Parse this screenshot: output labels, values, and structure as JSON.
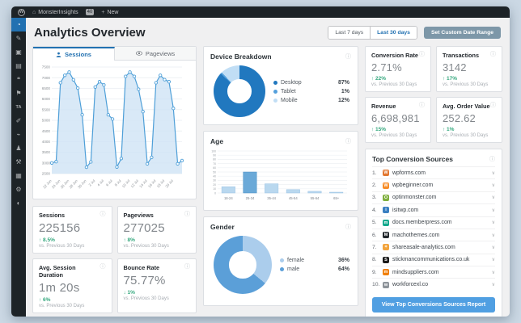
{
  "admin_bar": {
    "site_name": "MonsterInsights",
    "comments_count": "40",
    "new_label": "New",
    "wp_logo_letter": "W"
  },
  "sidebar": {
    "items": [
      {
        "name": "dashboard",
        "glyph": "◔",
        "active": true
      },
      {
        "name": "posts",
        "glyph": "✎",
        "active": false
      },
      {
        "name": "media",
        "glyph": "▣",
        "active": false
      },
      {
        "name": "pages",
        "glyph": "▤",
        "active": false
      },
      {
        "name": "comments",
        "glyph": "❝",
        "active": false
      },
      {
        "name": "feedback",
        "glyph": "⚑",
        "active": false
      },
      {
        "name": "thirstyaffiliates",
        "glyph": "TA",
        "active": false
      },
      {
        "name": "appearance",
        "glyph": "✐",
        "active": false
      },
      {
        "name": "plugins",
        "glyph": "⌁",
        "active": false
      },
      {
        "name": "users",
        "glyph": "♟",
        "active": false
      },
      {
        "name": "tools",
        "glyph": "⚒",
        "active": false
      },
      {
        "name": "modules",
        "glyph": "▦",
        "active": false
      },
      {
        "name": "settings",
        "glyph": "⚙",
        "active": false
      },
      {
        "name": "collapse-menu",
        "glyph": "◐",
        "active": false
      }
    ]
  },
  "header": {
    "title": "Analytics Overview",
    "last7_label": "Last 7 days",
    "last30_label": "Last 30 days",
    "custom_range_label": "Set Custom Date Range"
  },
  "sessions_panel": {
    "tab_sessions": "Sessions",
    "tab_pageviews": "Pageviews"
  },
  "device_panel_title": "Device Breakdown",
  "age_panel_title": "Age",
  "gender_panel_title": "Gender",
  "stats_left": [
    {
      "label": "Sessions",
      "value": "225156",
      "change": "8.5%",
      "direction": "up",
      "sub": "vs. Previous 30 Days"
    },
    {
      "label": "Pageviews",
      "value": "277025",
      "change": "8%",
      "direction": "up",
      "sub": "vs. Previous 30 Days"
    },
    {
      "label": "Avg. Session Duration",
      "value": "1m 20s",
      "change": "6%",
      "direction": "up",
      "sub": "vs. Previous 30 Days"
    },
    {
      "label": "Bounce Rate",
      "value": "75.77%",
      "change": "1%",
      "direction": "down",
      "sub": "vs. Previous 30 Days"
    }
  ],
  "stats_right": [
    {
      "label": "Conversion Rate",
      "value": "2.71%",
      "change": "22%",
      "direction": "up",
      "sub": "vs. Previous 30 Days"
    },
    {
      "label": "Transactions",
      "value": "3142",
      "change": "17%",
      "direction": "up",
      "sub": "vs. Previous 30 Days"
    },
    {
      "label": "Revenue",
      "value": "6,698,981",
      "change": "15%",
      "direction": "up",
      "sub": "vs. Previous 30 Days"
    },
    {
      "label": "Avg. Order Value",
      "value": "252.62",
      "change": "1%",
      "direction": "up",
      "sub": "vs. Previous 30 Days"
    }
  ],
  "top_sources": {
    "title": "Top Conversion Sources",
    "button_label": "View Top Conversions Sources Report",
    "items": [
      {
        "rank": "1.",
        "domain": "wpforms.com",
        "icon_color": "#e27730",
        "icon_letter": "W"
      },
      {
        "rank": "2.",
        "domain": "wpbeginner.com",
        "icon_color": "#f78c26",
        "icon_letter": "W"
      },
      {
        "rank": "3.",
        "domain": "optinmonster.com",
        "icon_color": "#7faf3d",
        "icon_letter": "O"
      },
      {
        "rank": "4.",
        "domain": "isitwp.com",
        "icon_color": "#3a7fc1",
        "icon_letter": "i"
      },
      {
        "rank": "5.",
        "domain": "docs.memberpress.com",
        "icon_color": "#13a88c",
        "icon_letter": "m"
      },
      {
        "rank": "6.",
        "domain": "machothemes.com",
        "icon_color": "#23282d",
        "icon_letter": "M"
      },
      {
        "rank": "7.",
        "domain": "shareasale-analytics.com",
        "icon_color": "#f2a33c",
        "icon_letter": "✶"
      },
      {
        "rank": "8.",
        "domain": "stickmancommunications.co.uk",
        "icon_color": "#1a1a1a",
        "icon_letter": "S"
      },
      {
        "rank": "9.",
        "domain": "mindsuppliers.com",
        "icon_color": "#f07f09",
        "icon_letter": "m"
      },
      {
        "rank": "10.",
        "domain": "workforcexl.co",
        "icon_color": "#8d9399",
        "icon_letter": "w"
      }
    ]
  },
  "chart_data": [
    {
      "type": "line",
      "name": "sessions-over-time",
      "title": "Sessions",
      "series": [
        {
          "name": "Sessions",
          "values": [
            3000,
            3060,
            6760,
            7110,
            7260,
            6900,
            6510,
            5260,
            2800,
            3050,
            6560,
            6810,
            6660,
            5260,
            5060,
            2810,
            3210,
            7060,
            7260,
            7060,
            6460,
            5410,
            2960,
            3260,
            6760,
            7110,
            6910,
            6810,
            5560,
            2960,
            3110
          ]
        }
      ],
      "x_tick_labels": [
        "22 Jun",
        "24 Jun",
        "26 Jun",
        "28 Jun",
        "30 Jun",
        "2 Jul",
        "4 Jul",
        "6 Jul",
        "8 Jul",
        "10 Jul",
        "12 Jul",
        "14 Jul",
        "16 Jul",
        "18 Jul",
        "20 Jul"
      ],
      "x_tick_every": 2,
      "ylim": [
        2500,
        7500
      ],
      "ytick_step": 500,
      "grid": true,
      "line_color": "#4e9fd8",
      "fill_color": "#cfe3f5"
    },
    {
      "type": "pie",
      "name": "device-breakdown",
      "title": "Device Breakdown",
      "labels": [
        "Desktop",
        "Tablet",
        "Mobile"
      ],
      "values": [
        87,
        1,
        12
      ],
      "display_values": [
        "87%",
        "1%",
        "12%"
      ],
      "colors": [
        "#2178bf",
        "#54a0dc",
        "#c1def5"
      ],
      "legend_position": "right"
    },
    {
      "type": "bar",
      "name": "age-distribution",
      "title": "Age",
      "categories": [
        "18-24",
        "25-34",
        "35-44",
        "45-54",
        "55-64",
        "65+"
      ],
      "values": [
        15,
        50,
        22,
        8,
        4,
        2
      ],
      "ylim": [
        0,
        100
      ],
      "ytick_step": 10,
      "highlight_index": 1,
      "bar_color": "#b9d8ef",
      "highlight_color": "#6aa9d8"
    },
    {
      "type": "pie",
      "name": "gender-split",
      "title": "Gender",
      "labels": [
        "female",
        "male"
      ],
      "values": [
        36,
        64
      ],
      "display_values": [
        "36%",
        "64%"
      ],
      "colors": [
        "#abcdec",
        "#5b9fd8"
      ],
      "legend_position": "right"
    }
  ]
}
